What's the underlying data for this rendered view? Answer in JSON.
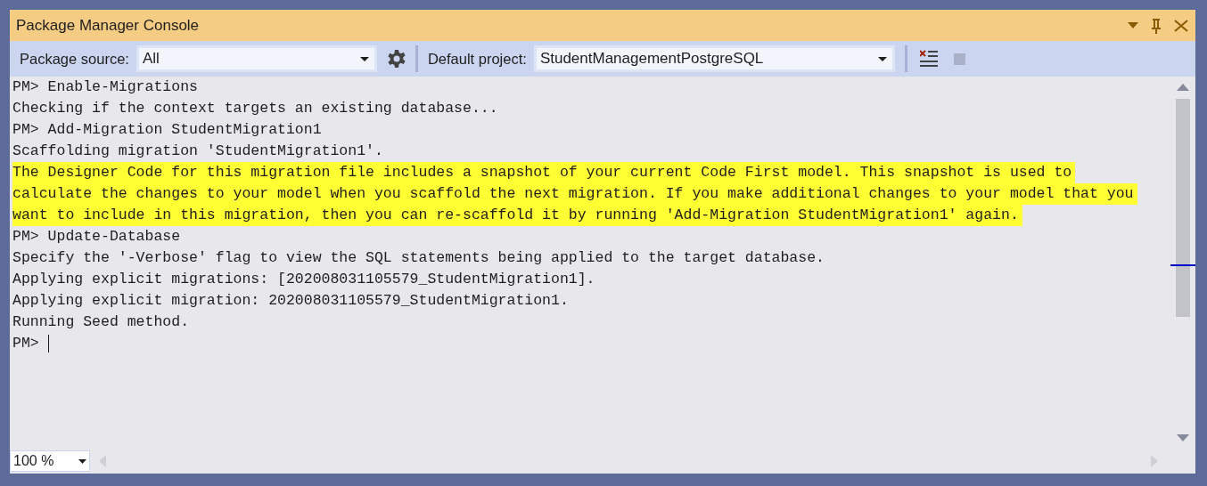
{
  "window": {
    "title": "Package Manager Console"
  },
  "toolbar": {
    "package_source": {
      "label": "Package source:",
      "value": "All"
    },
    "default_project": {
      "label": "Default project:",
      "value": "StudentManagementPostgreSQL"
    },
    "stop_button": {
      "disabled": true
    }
  },
  "console": {
    "lines": [
      {
        "kind": "normal",
        "text": "PM> Enable-Migrations"
      },
      {
        "kind": "normal",
        "text": "Checking if the context targets an existing database..."
      },
      {
        "kind": "normal",
        "text": "PM> Add-Migration StudentMigration1"
      },
      {
        "kind": "normal",
        "text": "Scaffolding migration 'StudentMigration1'."
      },
      {
        "kind": "highlighted",
        "text": "The Designer Code for this migration file includes a snapshot of your current Code First model. This snapshot is used to"
      },
      {
        "kind": "highlighted",
        "text": "calculate the changes to your model when you scaffold the next migration. If you make additional changes to your model that you"
      },
      {
        "kind": "highlighted",
        "text": "want to include in this migration, then you can re-scaffold it by running 'Add-Migration StudentMigration1' again."
      },
      {
        "kind": "normal",
        "text": "PM> Update-Database"
      },
      {
        "kind": "normal",
        "text": "Specify the '-Verbose' flag to view the SQL statements being applied to the target database."
      },
      {
        "kind": "normal",
        "text": "Applying explicit migrations: [202008031105579_StudentMigration1]."
      },
      {
        "kind": "normal",
        "text": "Applying explicit migration: 202008031105579_StudentMigration1."
      },
      {
        "kind": "normal",
        "text": "Running Seed method."
      },
      {
        "kind": "prompt",
        "text": "PM>"
      }
    ]
  },
  "zoom": {
    "value": "100 %"
  }
}
